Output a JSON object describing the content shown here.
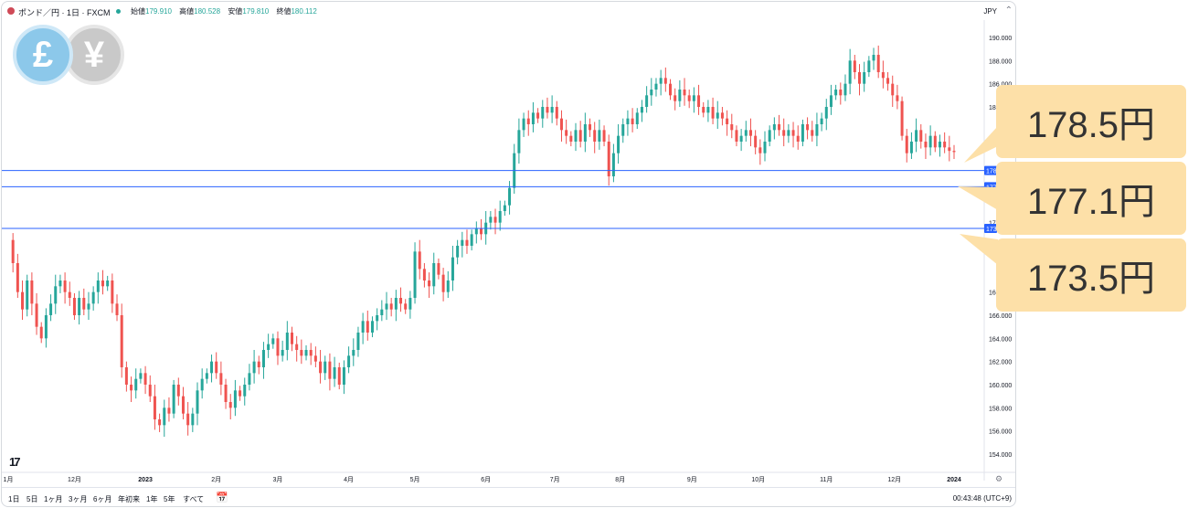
{
  "header": {
    "symbol": "ポンド／円 · 1日 · FXCM",
    "open_label": "始値",
    "open": "179.910",
    "high_label": "高値",
    "high": "180.528",
    "low_label": "安値",
    "low": "179.810",
    "close_label": "終値",
    "close": "180.112",
    "currency": "JPY"
  },
  "icons": {
    "gbp": "£",
    "jpy": "¥",
    "chevron": "⌃",
    "calendar": "📅",
    "gear": "⚙"
  },
  "bottom": {
    "timeframes": [
      "1日",
      "5日",
      "1ヶ月",
      "3ヶ月",
      "6ヶ月",
      "年初来",
      "1年",
      "5年",
      "すべて"
    ],
    "time": "00:43:48 (UTC+9)"
  },
  "logo": "17",
  "callouts": [
    "178.5円",
    "177.1円",
    "173.5円"
  ],
  "colors": {
    "up": "#26a69a",
    "down": "#ef5350",
    "level": "#2962ff",
    "callout": "#fde0a8"
  },
  "chart_data": {
    "type": "candlestick",
    "title": "",
    "ylabel": "",
    "ylim": [
      152.5,
      191.5
    ],
    "y_ticks": [
      "190.000",
      "188.000",
      "186.000",
      "184",
      "",
      "",
      "",
      "",
      "172",
      "",
      "",
      "168",
      "166.000",
      "164.000",
      "162.000",
      "160.000",
      "158.000",
      "156.000",
      "154.000"
    ],
    "y_tick_values": [
      190,
      188,
      186,
      184,
      182,
      180,
      178,
      176,
      174,
      172,
      170,
      168,
      166,
      164,
      162,
      160,
      158,
      156,
      154
    ],
    "x_ticks": [
      {
        "label": "1月",
        "t": 0
      },
      {
        "label": "12月",
        "t": 0.07
      },
      {
        "label": "2023",
        "t": 0.145
      },
      {
        "label": "2月",
        "t": 0.22
      },
      {
        "label": "3月",
        "t": 0.285
      },
      {
        "label": "4月",
        "t": 0.36
      },
      {
        "label": "5月",
        "t": 0.43
      },
      {
        "label": "6月",
        "t": 0.505
      },
      {
        "label": "7月",
        "t": 0.578
      },
      {
        "label": "8月",
        "t": 0.647
      },
      {
        "label": "9月",
        "t": 0.723
      },
      {
        "label": "10月",
        "t": 0.793
      },
      {
        "label": "11月",
        "t": 0.865
      },
      {
        "label": "12月",
        "t": 0.937
      },
      {
        "label": "2024",
        "t": 1.0
      }
    ],
    "levels": [
      {
        "value": 178.5,
        "axis_label": "178"
      },
      {
        "value": 177.1,
        "axis_label": "177"
      },
      {
        "value": 173.5,
        "axis_label": "173"
      }
    ],
    "close_path": [
      [
        0.0,
        172.5
      ],
      [
        0.005,
        170.5
      ],
      [
        0.01,
        168.0
      ],
      [
        0.015,
        166.5
      ],
      [
        0.02,
        169.0
      ],
      [
        0.025,
        167.0
      ],
      [
        0.03,
        165.0
      ],
      [
        0.035,
        164.0
      ],
      [
        0.04,
        166.0
      ],
      [
        0.045,
        167.0
      ],
      [
        0.05,
        168.5
      ],
      [
        0.055,
        169.0
      ],
      [
        0.06,
        168.0
      ],
      [
        0.065,
        167.5
      ],
      [
        0.07,
        166.0
      ],
      [
        0.075,
        167.5
      ],
      [
        0.08,
        166.5
      ],
      [
        0.085,
        167.0
      ],
      [
        0.09,
        168.0
      ],
      [
        0.095,
        169.0
      ],
      [
        0.1,
        168.5
      ],
      [
        0.105,
        169.0
      ],
      [
        0.11,
        167.0
      ],
      [
        0.115,
        166.0
      ],
      [
        0.12,
        161.5
      ],
      [
        0.125,
        160.0
      ],
      [
        0.13,
        159.5
      ],
      [
        0.135,
        160.5
      ],
      [
        0.14,
        161.0
      ],
      [
        0.145,
        160.0
      ],
      [
        0.15,
        159.0
      ],
      [
        0.155,
        157.0
      ],
      [
        0.16,
        156.5
      ],
      [
        0.165,
        158.0
      ],
      [
        0.17,
        157.5
      ],
      [
        0.175,
        160.0
      ],
      [
        0.18,
        159.0
      ],
      [
        0.185,
        157.5
      ],
      [
        0.19,
        156.5
      ],
      [
        0.195,
        157.5
      ],
      [
        0.2,
        159.5
      ],
      [
        0.205,
        160.5
      ],
      [
        0.21,
        161.0
      ],
      [
        0.215,
        162.0
      ],
      [
        0.22,
        161.0
      ],
      [
        0.225,
        160.0
      ],
      [
        0.23,
        158.5
      ],
      [
        0.235,
        158.0
      ],
      [
        0.24,
        159.5
      ],
      [
        0.245,
        159.0
      ],
      [
        0.25,
        160.0
      ],
      [
        0.255,
        161.0
      ],
      [
        0.26,
        162.0
      ],
      [
        0.265,
        161.5
      ],
      [
        0.27,
        163.0
      ],
      [
        0.275,
        163.5
      ],
      [
        0.28,
        164.0
      ],
      [
        0.285,
        162.5
      ],
      [
        0.29,
        163.0
      ],
      [
        0.295,
        164.5
      ],
      [
        0.3,
        163.5
      ],
      [
        0.305,
        163.0
      ],
      [
        0.31,
        162.5
      ],
      [
        0.315,
        163.0
      ],
      [
        0.32,
        162.5
      ],
      [
        0.325,
        162.0
      ],
      [
        0.33,
        161.0
      ],
      [
        0.335,
        162.0
      ],
      [
        0.34,
        160.5
      ],
      [
        0.345,
        161.5
      ],
      [
        0.35,
        160.0
      ],
      [
        0.355,
        161.5
      ],
      [
        0.36,
        162.5
      ],
      [
        0.365,
        163.0
      ],
      [
        0.37,
        164.5
      ],
      [
        0.375,
        165.5
      ],
      [
        0.38,
        164.5
      ],
      [
        0.385,
        165.5
      ],
      [
        0.39,
        166.0
      ],
      [
        0.395,
        166.5
      ],
      [
        0.4,
        167.0
      ],
      [
        0.405,
        166.5
      ],
      [
        0.41,
        167.5
      ],
      [
        0.415,
        167.0
      ],
      [
        0.42,
        166.5
      ],
      [
        0.425,
        167.5
      ],
      [
        0.43,
        171.5
      ],
      [
        0.435,
        170.0
      ],
      [
        0.44,
        169.0
      ],
      [
        0.445,
        168.5
      ],
      [
        0.45,
        170.5
      ],
      [
        0.455,
        169.5
      ],
      [
        0.46,
        168.0
      ],
      [
        0.465,
        169.0
      ],
      [
        0.47,
        171.0
      ],
      [
        0.475,
        172.0
      ],
      [
        0.48,
        172.5
      ],
      [
        0.485,
        172.0
      ],
      [
        0.49,
        173.0
      ],
      [
        0.495,
        173.5
      ],
      [
        0.5,
        173.0
      ],
      [
        0.505,
        174.0
      ],
      [
        0.51,
        174.5
      ],
      [
        0.515,
        174.0
      ],
      [
        0.52,
        175.0
      ],
      [
        0.525,
        175.5
      ],
      [
        0.53,
        177.0
      ],
      [
        0.535,
        180.0
      ],
      [
        0.54,
        182.0
      ],
      [
        0.545,
        183.0
      ],
      [
        0.55,
        182.5
      ],
      [
        0.555,
        183.5
      ],
      [
        0.56,
        183.0
      ],
      [
        0.565,
        184.0
      ],
      [
        0.57,
        183.5
      ],
      [
        0.575,
        184.0
      ],
      [
        0.58,
        183.0
      ],
      [
        0.585,
        182.0
      ],
      [
        0.59,
        181.5
      ],
      [
        0.595,
        181.0
      ],
      [
        0.6,
        182.0
      ],
      [
        0.605,
        181.0
      ],
      [
        0.61,
        182.5
      ],
      [
        0.615,
        182.0
      ],
      [
        0.62,
        181.0
      ],
      [
        0.625,
        182.0
      ],
      [
        0.63,
        181.0
      ],
      [
        0.635,
        178.0
      ],
      [
        0.64,
        180.0
      ],
      [
        0.645,
        181.5
      ],
      [
        0.65,
        182.5
      ],
      [
        0.655,
        183.0
      ],
      [
        0.66,
        182.5
      ],
      [
        0.665,
        183.5
      ],
      [
        0.67,
        184.0
      ],
      [
        0.675,
        185.0
      ],
      [
        0.68,
        185.5
      ],
      [
        0.685,
        186.0
      ],
      [
        0.69,
        186.5
      ],
      [
        0.695,
        186.0
      ],
      [
        0.7,
        185.0
      ],
      [
        0.705,
        184.5
      ],
      [
        0.71,
        185.5
      ],
      [
        0.715,
        185.0
      ],
      [
        0.72,
        184.5
      ],
      [
        0.725,
        185.0
      ],
      [
        0.73,
        184.0
      ],
      [
        0.735,
        183.5
      ],
      [
        0.74,
        184.0
      ],
      [
        0.745,
        183.0
      ],
      [
        0.75,
        183.5
      ],
      [
        0.755,
        183.0
      ],
      [
        0.76,
        182.5
      ],
      [
        0.765,
        182.0
      ],
      [
        0.77,
        181.0
      ],
      [
        0.775,
        181.5
      ],
      [
        0.78,
        182.0
      ],
      [
        0.785,
        181.5
      ],
      [
        0.79,
        180.5
      ],
      [
        0.795,
        180.0
      ],
      [
        0.8,
        181.0
      ],
      [
        0.805,
        182.0
      ],
      [
        0.81,
        182.5
      ],
      [
        0.815,
        182.0
      ],
      [
        0.82,
        181.5
      ],
      [
        0.825,
        182.0
      ],
      [
        0.83,
        181.5
      ],
      [
        0.835,
        181.0
      ],
      [
        0.84,
        182.5
      ],
      [
        0.845,
        182.0
      ],
      [
        0.85,
        181.5
      ],
      [
        0.855,
        182.5
      ],
      [
        0.86,
        183.0
      ],
      [
        0.865,
        184.0
      ],
      [
        0.87,
        185.0
      ],
      [
        0.875,
        185.5
      ],
      [
        0.88,
        185.0
      ],
      [
        0.885,
        186.0
      ],
      [
        0.89,
        188.0
      ],
      [
        0.895,
        187.0
      ],
      [
        0.9,
        186.0
      ],
      [
        0.905,
        187.0
      ],
      [
        0.91,
        188.0
      ],
      [
        0.915,
        188.5
      ],
      [
        0.92,
        187.0
      ],
      [
        0.925,
        186.5
      ],
      [
        0.93,
        186.0
      ],
      [
        0.935,
        185.0
      ],
      [
        0.94,
        184.5
      ],
      [
        0.945,
        181.5
      ],
      [
        0.95,
        180.0
      ],
      [
        0.955,
        181.0
      ],
      [
        0.96,
        182.0
      ],
      [
        0.965,
        181.0
      ],
      [
        0.97,
        180.5
      ],
      [
        0.975,
        181.5
      ],
      [
        0.98,
        180.5
      ],
      [
        0.985,
        181.0
      ],
      [
        0.99,
        180.5
      ],
      [
        0.995,
        180.2
      ],
      [
        1.0,
        180.1
      ]
    ]
  }
}
